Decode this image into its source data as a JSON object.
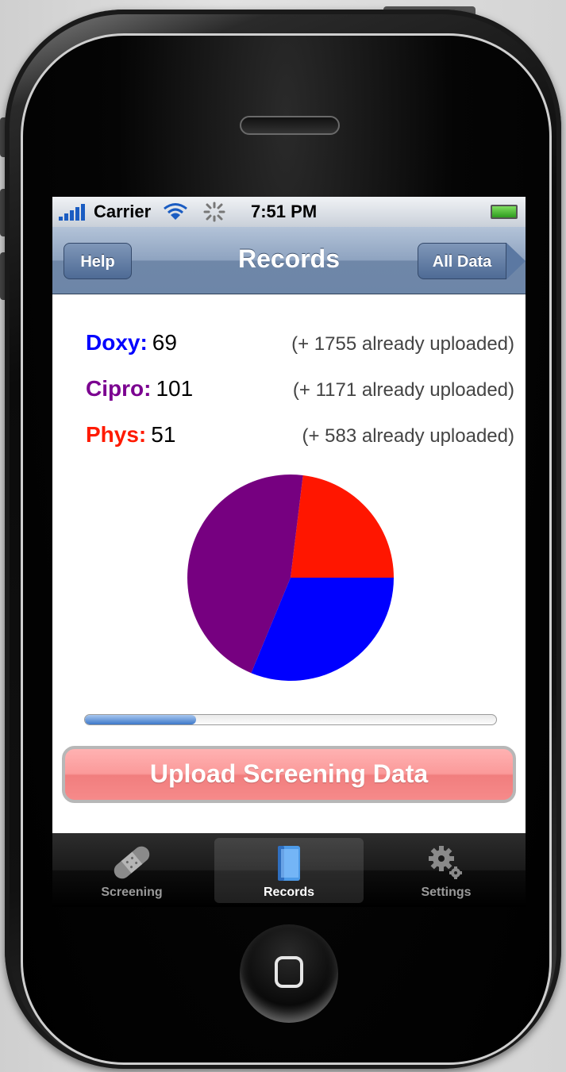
{
  "status_bar": {
    "carrier": "Carrier",
    "time": "7:51 PM"
  },
  "nav": {
    "title": "Records",
    "left_button": "Help",
    "right_button": "All Data"
  },
  "records": [
    {
      "drug": "Doxy:",
      "count": "69",
      "note": "(+ 1755 already uploaded)",
      "color": "#0000ff"
    },
    {
      "drug": "Cipro:",
      "count": "101",
      "note": "(+ 1171 already uploaded)",
      "color": "#7b0090"
    },
    {
      "drug": "Phys:",
      "count": "51",
      "note": "(+ 583 already uploaded)",
      "color": "#ff1a00"
    }
  ],
  "chart_data": {
    "type": "pie",
    "slices": [
      {
        "name": "Doxy",
        "value": 69,
        "color": "#0000ff"
      },
      {
        "name": "Cipro",
        "value": 101,
        "color": "#760080"
      },
      {
        "name": "Phys",
        "value": 51,
        "color": "#ff1600"
      }
    ]
  },
  "progress": {
    "fraction": 0.27
  },
  "upload_button": "Upload Screening Data",
  "tabs": [
    {
      "label": "Screening",
      "icon": "bandage-icon",
      "active": false
    },
    {
      "label": "Records",
      "icon": "book-icon",
      "active": true
    },
    {
      "label": "Settings",
      "icon": "gears-icon",
      "active": false
    }
  ]
}
